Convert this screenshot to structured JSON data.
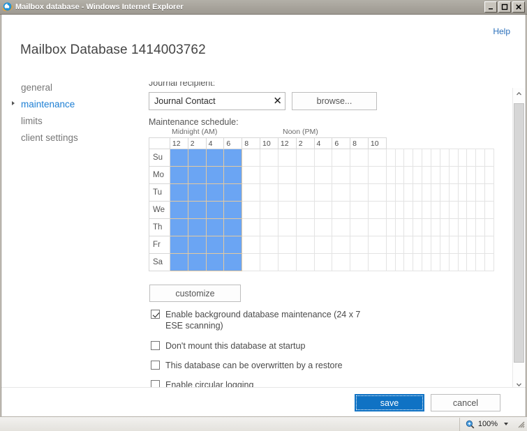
{
  "window": {
    "title": "Mailbox database - Windows Internet Explorer",
    "app_icon": "internet-explorer-icon",
    "minimize_label": "_",
    "maximize_label": "□",
    "close_label": "✕"
  },
  "page": {
    "help_label": "Help",
    "title": "Mailbox Database 1414003762"
  },
  "sidebar": {
    "items": [
      {
        "label": "general",
        "active": false
      },
      {
        "label": "maintenance",
        "active": true
      },
      {
        "label": "limits",
        "active": false
      },
      {
        "label": "client settings",
        "active": false
      }
    ]
  },
  "journal": {
    "label": "Journal recipient:",
    "value": "Journal Contact",
    "placeholder": "",
    "clear_label": "✕",
    "browse_label": "browse..."
  },
  "schedule": {
    "label": "Maintenance schedule:",
    "midnight_label": "Midnight (AM)",
    "noon_label": "Noon (PM)",
    "hour_headers": [
      "12",
      "2",
      "4",
      "6",
      "8",
      "10",
      "12",
      "2",
      "4",
      "6",
      "8",
      "10"
    ],
    "days": [
      "Su",
      "Mo",
      "Tu",
      "We",
      "Th",
      "Fr",
      "Sa"
    ],
    "selected_start_hour": 0,
    "selected_end_hour": 4,
    "selected_color": "#6ba5f3",
    "customize_label": "customize"
  },
  "checkboxes": [
    {
      "label": "Enable background database maintenance (24 x 7 ESE scanning)",
      "checked": true
    },
    {
      "label": "Don't mount this database at startup",
      "checked": false
    },
    {
      "label": "This database can be overwritten by a restore",
      "checked": false
    },
    {
      "label": "Enable circular logging",
      "checked": false
    }
  ],
  "footer": {
    "save_label": "save",
    "cancel_label": "cancel",
    "save_color": "#0f72c4"
  },
  "statusbar": {
    "zoom_label": "100%",
    "zoom_icon": "magnifier-icon"
  }
}
